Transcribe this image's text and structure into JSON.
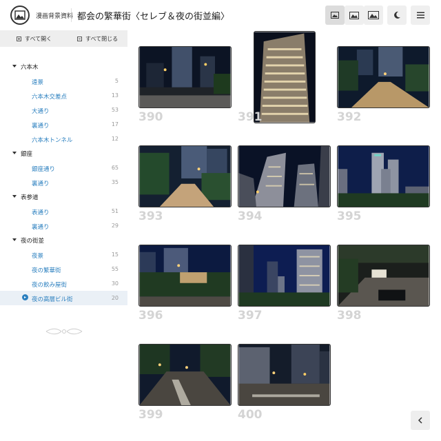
{
  "header": {
    "site_name": "漫画背景資料",
    "title": "都会の繁華街〈セレブ＆夜の街並編〉",
    "buttons": [
      {
        "name": "small-image-view-button",
        "icon": "image-small-icon",
        "active": true
      },
      {
        "name": "medium-image-view-button",
        "icon": "image-medium-icon",
        "active": false
      },
      {
        "name": "large-image-view-button",
        "icon": "image-large-icon",
        "active": false
      },
      {
        "name": "dark-mode-button",
        "icon": "moon-icon",
        "active": false
      },
      {
        "name": "menu-button",
        "icon": "hamburger-icon",
        "active": false
      }
    ]
  },
  "sidebar": {
    "expand_all": "すべて開く",
    "collapse_all": "すべて閉じる",
    "groups": [
      {
        "label": "六本木",
        "items": [
          {
            "label": "遠景",
            "count": "5"
          },
          {
            "label": "六本木交差点",
            "count": "13"
          },
          {
            "label": "大通り",
            "count": "53"
          },
          {
            "label": "裏通り",
            "count": "17"
          },
          {
            "label": "六本木トンネル",
            "count": "12"
          }
        ]
      },
      {
        "label": "銀座",
        "items": [
          {
            "label": "銀座通り",
            "count": "65"
          },
          {
            "label": "裏通り",
            "count": "35"
          }
        ]
      },
      {
        "label": "表参道",
        "items": [
          {
            "label": "表通り",
            "count": "51"
          },
          {
            "label": "裏通り",
            "count": "29"
          }
        ]
      },
      {
        "label": "夜の街並",
        "items": [
          {
            "label": "夜景",
            "count": "15"
          },
          {
            "label": "夜の繁華街",
            "count": "55"
          },
          {
            "label": "夜の飲み屋街",
            "count": "30"
          },
          {
            "label": "夜の高層ビル街",
            "count": "20",
            "active": true
          }
        ]
      }
    ]
  },
  "gallery": {
    "items": [
      {
        "num": "390",
        "scene": "street-night"
      },
      {
        "num": "391",
        "scene": "tower-portrait"
      },
      {
        "num": "392",
        "scene": "walkway-night"
      },
      {
        "num": "393",
        "scene": "walkway-trees"
      },
      {
        "num": "394",
        "scene": "towers-up"
      },
      {
        "num": "395",
        "scene": "city-hall"
      },
      {
        "num": "396",
        "scene": "plaza-trees"
      },
      {
        "num": "397",
        "scene": "skyline-blue"
      },
      {
        "num": "398",
        "scene": "underpass"
      },
      {
        "num": "399",
        "scene": "road-crosswalk"
      },
      {
        "num": "400",
        "scene": "intersection"
      }
    ]
  },
  "colors": {
    "accent": "#2a7fbf",
    "number_gray": "#d4d4d4",
    "sidebar_bar": "#eeeeee"
  },
  "back_button_icon": "chevron-left-icon"
}
